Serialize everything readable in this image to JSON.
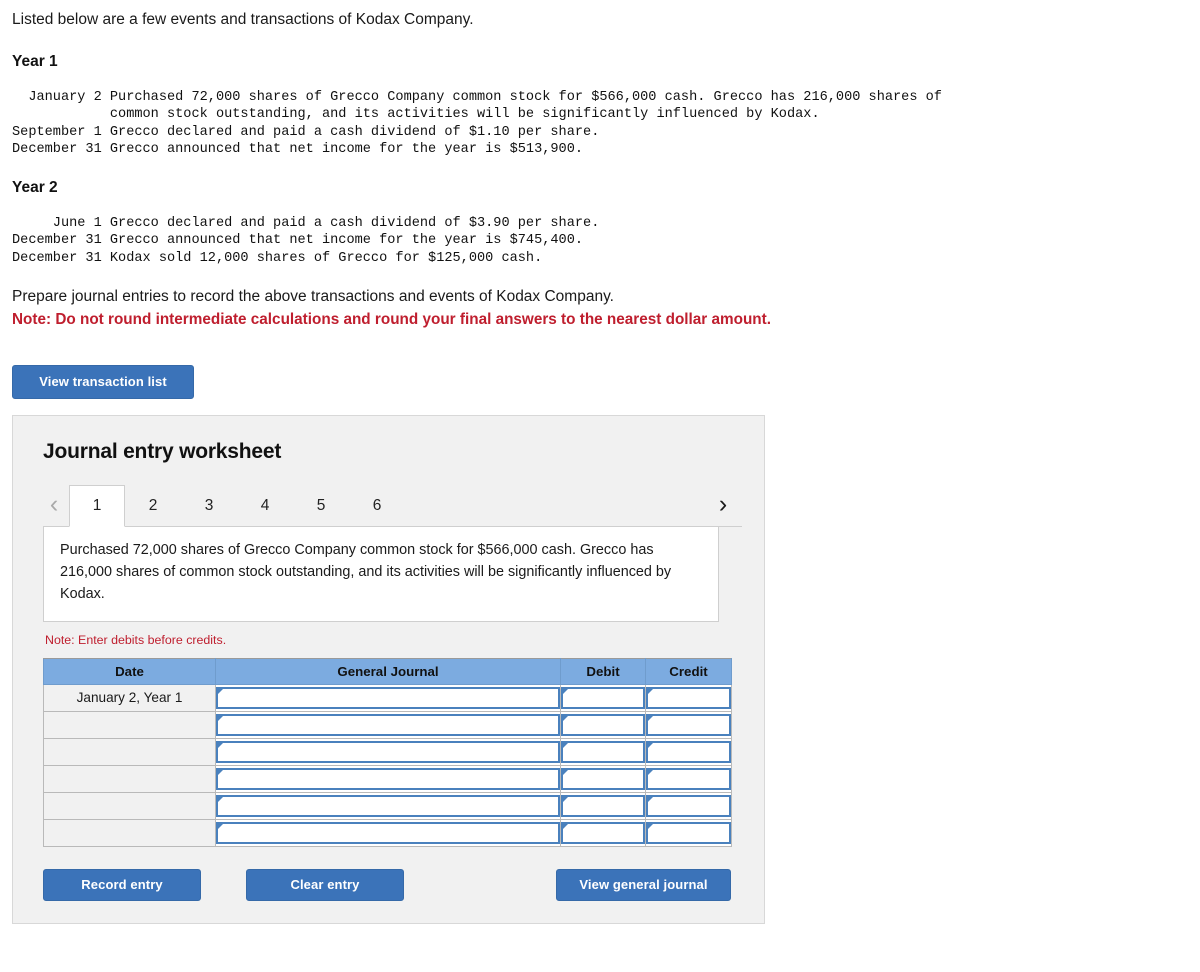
{
  "problem": {
    "intro": "Listed below are a few events and transactions of Kodax Company.",
    "year1_heading": "Year 1",
    "year1_lines": "  January 2 Purchased 72,000 shares of Grecco Company common stock for $566,000 cash. Grecco has 216,000 shares of\n            common stock outstanding, and its activities will be significantly influenced by Kodax.\nSeptember 1 Grecco declared and paid a cash dividend of $1.10 per share.\nDecember 31 Grecco announced that net income for the year is $513,900.",
    "year2_heading": "Year 2",
    "year2_lines": "     June 1 Grecco declared and paid a cash dividend of $3.90 per share.\nDecember 31 Grecco announced that net income for the year is $745,400.\nDecember 31 Kodax sold 12,000 shares of Grecco for $125,000 cash.",
    "prepare": "Prepare journal entries to record the above transactions and events of Kodax Company.",
    "note": "Note: Do not round intermediate calculations and round your final answers to the nearest dollar amount."
  },
  "view_transaction_list_label": "View transaction list",
  "worksheet": {
    "title": "Journal entry worksheet",
    "prev_arrow": "‹",
    "next_arrow": "›",
    "tabs": [
      {
        "label": "1",
        "active": true
      },
      {
        "label": "2",
        "active": false
      },
      {
        "label": "3",
        "active": false
      },
      {
        "label": "4",
        "active": false
      },
      {
        "label": "5",
        "active": false
      },
      {
        "label": "6",
        "active": false
      }
    ],
    "description": "Purchased 72,000 shares of Grecco Company common stock for $566,000 cash. Grecco has 216,000 shares of common stock outstanding, and its activities will be significantly influenced by Kodax.",
    "note": "Note: Enter debits before credits.",
    "table": {
      "columns": [
        "Date",
        "General Journal",
        "Debit",
        "Credit"
      ],
      "rows": [
        {
          "date": "January 2, Year 1",
          "general_journal": "",
          "debit": "",
          "credit": ""
        },
        {
          "date": "",
          "general_journal": "",
          "debit": "",
          "credit": ""
        },
        {
          "date": "",
          "general_journal": "",
          "debit": "",
          "credit": ""
        },
        {
          "date": "",
          "general_journal": "",
          "debit": "",
          "credit": ""
        },
        {
          "date": "",
          "general_journal": "",
          "debit": "",
          "credit": ""
        },
        {
          "date": "",
          "general_journal": "",
          "debit": "",
          "credit": ""
        }
      ]
    },
    "buttons": {
      "record": "Record entry",
      "clear": "Clear entry",
      "view_general_journal": "View general journal"
    }
  },
  "colors": {
    "button_blue": "#3b73b9",
    "table_header_blue": "#7cabe0",
    "input_border_blue": "#4a81bd",
    "note_red": "#bf1e2e",
    "panel_bg": "#f1f1f1"
  }
}
